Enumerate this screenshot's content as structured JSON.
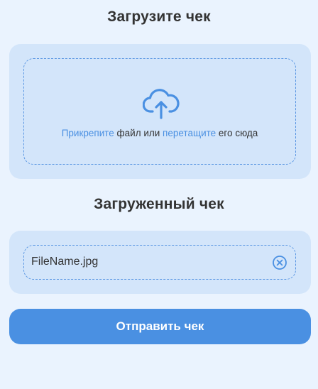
{
  "upload_section": {
    "title": "Загрузите чек",
    "dropzone": {
      "icon": "cloud-upload-icon",
      "attach_link": "Прикрепите",
      "text_middle": " файл или ",
      "drag_link": "перетащите",
      "text_end": " его сюда"
    }
  },
  "uploaded_section": {
    "title": "Загруженный чек",
    "file_name": "FileName.jpg",
    "clear_icon": "close-circle-icon"
  },
  "submit_button": {
    "label": "Отправить чек"
  },
  "colors": {
    "background": "#eaf3fe",
    "panel": "#d3e5fa",
    "accent": "#4a90e2",
    "text": "#333333"
  }
}
